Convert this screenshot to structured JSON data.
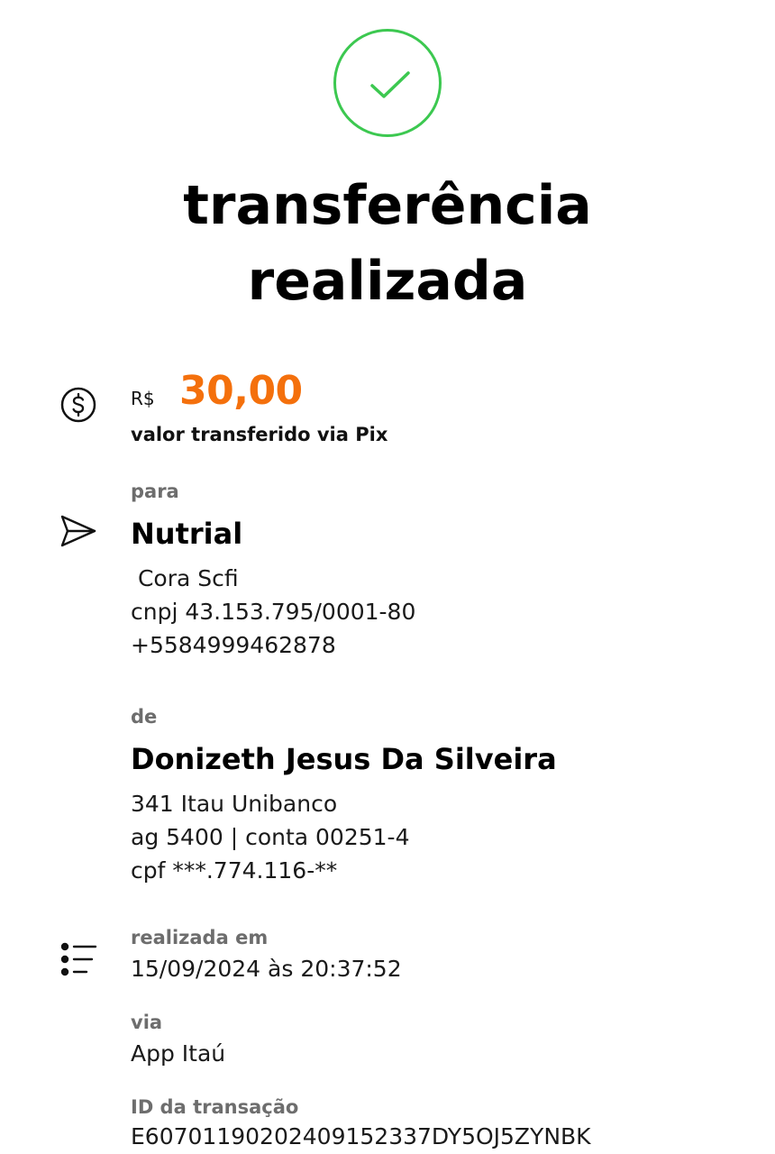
{
  "title": {
    "line1": "transferência",
    "line2": "realizada"
  },
  "colors": {
    "success": "#3cc850",
    "amount": "#f4700c",
    "label": "#6d6d6d"
  },
  "amount": {
    "currency": "R$",
    "value": "30,00",
    "caption": "valor transferido via Pix",
    "icon": "dollar-circle-icon"
  },
  "recipient": {
    "label": "para",
    "name": "Nutrial",
    "bank": " Cora Scfi",
    "document": "cnpj 43.153.795/0001-80",
    "key": "+5584999462878",
    "icon": "send-icon"
  },
  "sender": {
    "label": "de",
    "name": "Donizeth Jesus Da Silveira",
    "bank": "341 Itau Unibanco",
    "account": "ag 5400 | conta 00251-4",
    "document": "cpf ***.774.116-**"
  },
  "details": {
    "icon": "list-icon",
    "date_label": "realizada em",
    "date_value": "15/09/2024 às 20:37:52",
    "via_label": "via",
    "via_value": "App Itaú",
    "id_label": "ID da transação",
    "id_value": "E60701190202409152337DY5OJ5ZYNBK"
  }
}
